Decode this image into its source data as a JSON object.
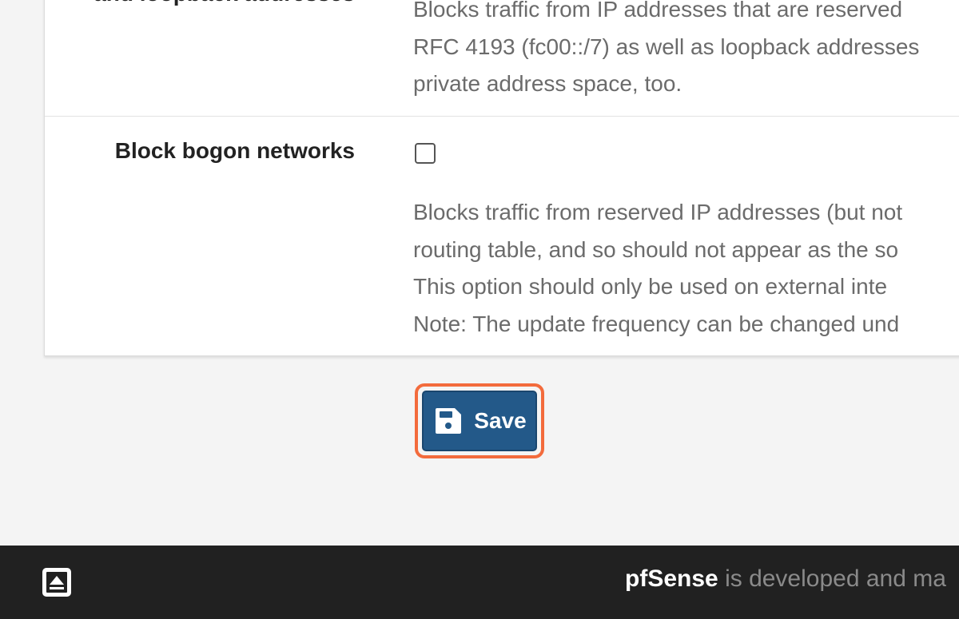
{
  "settings": {
    "rows": [
      {
        "label": "and loopback addresses",
        "help_lines": [
          "Blocks traffic from IP addresses that are reserved",
          "RFC 4193 (fc00::/7) as well as loopback addresses",
          "private address space, too."
        ]
      },
      {
        "label": "Block bogon networks",
        "checked": false,
        "help_lines": [
          "Blocks traffic from reserved IP addresses (but not",
          "routing table, and so should not appear as the so",
          "This option should only be used on external inte",
          "Note: The update frequency can be changed und"
        ]
      }
    ]
  },
  "actions": {
    "save_label": "Save",
    "save_icon": "floppy-disk-icon",
    "button_color": "#235989",
    "highlight_color": "#f36b3c"
  },
  "footer": {
    "icon": "scroll-to-top-icon",
    "brand": "pfSense",
    "text": "is developed and ma"
  }
}
